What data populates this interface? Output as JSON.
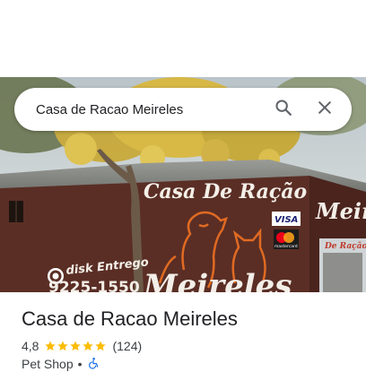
{
  "search": {
    "value": "Casa de Racao Meireles",
    "search_icon": "search-icon",
    "clear_icon": "close-icon"
  },
  "photo": {
    "sign_main": "Casa De Ração",
    "sign_bottom": "Meireles",
    "sign_side": "Meirel",
    "phone_top": "disk Entrego",
    "phone_number": "9225-1550",
    "visa_label": "VISA",
    "mastercard_label": "mastercard",
    "shop_sign": "De Ração"
  },
  "place": {
    "name": "Casa de Racao Meireles",
    "rating": "4,8",
    "stars": 5,
    "reviews": "(124)",
    "category": "Pet Shop",
    "separator": "•",
    "accessibility_icon": "wheelchair-icon"
  },
  "colors": {
    "star": "#fbbc04",
    "accessible": "#1a73e8",
    "wall": "#5a2e25"
  }
}
